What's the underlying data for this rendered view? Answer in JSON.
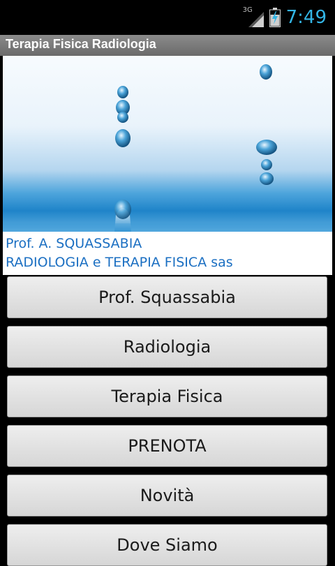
{
  "status_bar": {
    "network_label": "3G",
    "time": "7:49",
    "accent_color": "#33b5e5",
    "icons": [
      "signal-icon",
      "battery-charging-icon"
    ]
  },
  "app": {
    "title": "Terapia Fisica Radiologia"
  },
  "banner": {
    "caption_line1": "Prof. A. SQUASSABIA",
    "caption_line2": "RADIOLOGIA e TERAPIA FISICA sas",
    "caption_color": "#1b6fc2"
  },
  "menu": {
    "items": [
      {
        "label": "Prof. Squassabia"
      },
      {
        "label": "Radiologia"
      },
      {
        "label": "Terapia Fisica"
      },
      {
        "label": "PRENOTA"
      },
      {
        "label": "Novità"
      },
      {
        "label": "Dove Siamo"
      }
    ]
  }
}
